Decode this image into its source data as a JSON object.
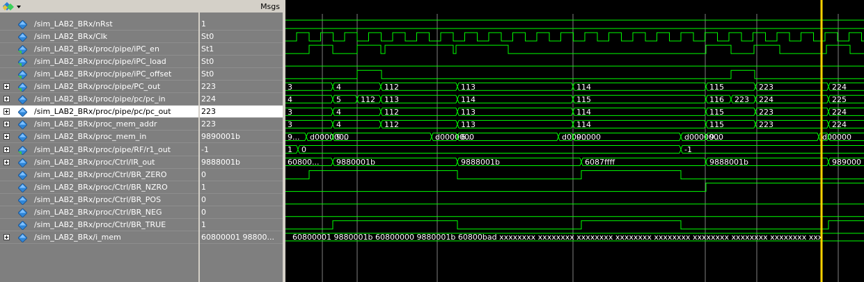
{
  "header": {
    "values_title": "Msgs"
  },
  "signals": [
    {
      "name": "/sim_LAB2_BRx/nRst",
      "value": "1",
      "expandable": false,
      "icon": "signal-diamond-icon"
    },
    {
      "name": "/sim_LAB2_BRx/Clk",
      "value": "St0",
      "expandable": false,
      "icon": "signal-diamond-icon"
    },
    {
      "name": "/sim_LAB2_BRx/proc/pipe/iPC_en",
      "value": "St1",
      "expandable": false,
      "icon": "signal-diamond-arrow-icon"
    },
    {
      "name": "/sim_LAB2_BRx/proc/pipe/iPC_load",
      "value": "St0",
      "expandable": false,
      "icon": "signal-diamond-arrow-icon"
    },
    {
      "name": "/sim_LAB2_BRx/proc/pipe/iPC_offset",
      "value": "St0",
      "expandable": false,
      "icon": "signal-diamond-arrow-icon"
    },
    {
      "name": "/sim_LAB2_BRx/proc/pipe/PC_out",
      "value": "223",
      "expandable": true,
      "icon": "signal-diamond-arrow-icon"
    },
    {
      "name": "/sim_LAB2_BRx/proc/pipe/pc/pc_in",
      "value": "224",
      "expandable": true,
      "icon": "signal-diamond-icon"
    },
    {
      "name": "/sim_LAB2_BRx/proc/pipe/pc/pc_out",
      "value": "223",
      "expandable": true,
      "icon": "signal-diamond-icon",
      "selected": true
    },
    {
      "name": "/sim_LAB2_BRx/proc_mem_addr",
      "value": "223",
      "expandable": true,
      "icon": "signal-diamond-icon"
    },
    {
      "name": "/sim_LAB2_BRx/proc_mem_in",
      "value": "9890001b",
      "expandable": true,
      "icon": "signal-diamond-icon"
    },
    {
      "name": "/sim_LAB2_BRx/proc/pipe/RF/r1_out",
      "value": "-1",
      "expandable": true,
      "icon": "signal-diamond-arrow-icon"
    },
    {
      "name": "/sim_LAB2_BRx/proc/Ctrl/IR_out",
      "value": "9888001b",
      "expandable": true,
      "icon": "signal-diamond-icon"
    },
    {
      "name": "/sim_LAB2_BRx/proc/Ctrl/BR_ZERO",
      "value": "0",
      "expandable": false,
      "icon": "signal-diamond-icon"
    },
    {
      "name": "/sim_LAB2_BRx/proc/Ctrl/BR_NZRO",
      "value": "1",
      "expandable": false,
      "icon": "signal-diamond-icon"
    },
    {
      "name": "/sim_LAB2_BRx/proc/Ctrl/BR_POS",
      "value": "0",
      "expandable": false,
      "icon": "signal-diamond-icon"
    },
    {
      "name": "/sim_LAB2_BRx/proc/Ctrl/BR_NEG",
      "value": "0",
      "expandable": false,
      "icon": "signal-diamond-icon"
    },
    {
      "name": "/sim_LAB2_BRx/proc/Ctrl/BR_TRUE",
      "value": "1",
      "expandable": false,
      "icon": "signal-diamond-icon"
    },
    {
      "name": "/sim_LAB2_BRx/i_mem",
      "value": "60800001 98800...",
      "expandable": true,
      "icon": "signal-diamond-icon"
    }
  ],
  "waveforms": {
    "bus_labels": {
      "PC_out": [
        "3",
        "4",
        "112",
        "113",
        "114",
        "115",
        "223",
        "224"
      ],
      "pc_in": [
        "4",
        "5",
        "112",
        "113",
        "114",
        "115",
        "116",
        "223",
        "224",
        "225"
      ],
      "pc_out": [
        "3",
        "4",
        "112",
        "113",
        "114",
        "115",
        "223",
        "224"
      ],
      "proc_mem_addr": [
        "3",
        "4",
        "112",
        "113",
        "114",
        "115",
        "223",
        "224"
      ],
      "proc_mem_in": [
        "9...",
        "d0000000",
        "9...",
        "d0000000",
        "6...",
        "d0000000",
        "9...",
        "d0000000",
        "9...",
        "d00000"
      ],
      "r1_out": [
        "1",
        "0",
        "-1"
      ],
      "IR_out": [
        "60800...",
        "9880001b",
        "9888001b",
        "6087ffff",
        "9888001b",
        "989000"
      ],
      "i_mem": "60800001 9880001b 60800000 9880001b 60800bad xxxxxxxx xxxxxxxx xxxxxxxx xxxxxxxx xxxxxxxx xxxxxxxx xxxxxxxx xxxxxxxx xxx"
    }
  },
  "colors": {
    "wave": "#00ff00",
    "cursor": "#ffd200",
    "grid": "#808080"
  }
}
